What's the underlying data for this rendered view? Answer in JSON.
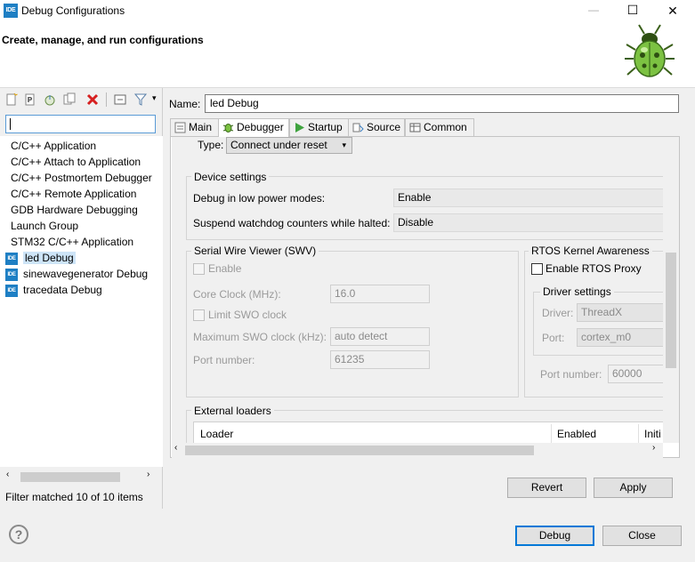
{
  "window": {
    "app_icon_text": "IDE",
    "title": "Debug Configurations",
    "minimize": "—",
    "maximize": "☐",
    "close": "✕"
  },
  "header": {
    "title": "Create, manage, and run configurations"
  },
  "left": {
    "filter_placeholder": "",
    "tree": [
      {
        "label": "C/C++ Application",
        "icon": "none",
        "selected": false
      },
      {
        "label": "C/C++ Attach to Application",
        "icon": "none",
        "selected": false
      },
      {
        "label": "C/C++ Postmortem Debugger",
        "icon": "none",
        "selected": false
      },
      {
        "label": "C/C++ Remote Application",
        "icon": "none",
        "selected": false
      },
      {
        "label": "GDB Hardware Debugging",
        "icon": "none",
        "selected": false
      },
      {
        "label": "Launch Group",
        "icon": "none",
        "selected": false
      },
      {
        "label": "STM32 C/C++ Application",
        "icon": "none",
        "selected": false
      },
      {
        "label": "led Debug",
        "icon": "IDE",
        "selected": true
      },
      {
        "label": "sinewavegenerator Debug",
        "icon": "IDE",
        "selected": false
      },
      {
        "label": "tracedata Debug",
        "icon": "IDE",
        "selected": false
      }
    ],
    "status": "Filter matched 10 of 10 items"
  },
  "config": {
    "name_label": "Name:",
    "name_value": "led Debug",
    "tabs": [
      {
        "label": "Main",
        "icon": "main-tab-icon",
        "active": false
      },
      {
        "label": "Debugger",
        "icon": "debugger-tab-icon",
        "active": true
      },
      {
        "label": "Startup",
        "icon": "startup-tab-icon",
        "active": false
      },
      {
        "label": "Source",
        "icon": "source-tab-icon",
        "active": false
      },
      {
        "label": "Common",
        "icon": "common-tab-icon",
        "active": false
      }
    ],
    "type_label": "Type:",
    "type_value": "Connect under reset",
    "device_settings": {
      "title": "Device settings",
      "low_power_label": "Debug in low power modes:",
      "low_power_value": "Enable",
      "watchdog_label": "Suspend watchdog counters while halted:",
      "watchdog_value": "Disable"
    },
    "swv": {
      "title": "Serial Wire Viewer (SWV)",
      "enable_label": "Enable",
      "core_clock_label": "Core Clock (MHz):",
      "core_clock_value": "16.0",
      "limit_label": "Limit SWO clock",
      "max_swo_label": "Maximum SWO clock (kHz):",
      "max_swo_value": "auto detect",
      "port_label": "Port number:",
      "port_value": "61235"
    },
    "rtos": {
      "title": "RTOS Kernel Awareness",
      "enable_label": "Enable RTOS Proxy",
      "driver_settings_title": "Driver settings",
      "driver_label": "Driver:",
      "driver_value": "ThreadX",
      "port_label": "Port:",
      "port_value": "cortex_m0",
      "port_number_label": "Port number:",
      "port_number_value": "60000"
    },
    "external_loaders": {
      "title": "External loaders",
      "columns": [
        "Loader",
        "Enabled",
        "Initi"
      ]
    },
    "revert": "Revert",
    "apply": "Apply"
  },
  "footer": {
    "help": "?",
    "debug": "Debug",
    "close": "Close"
  }
}
